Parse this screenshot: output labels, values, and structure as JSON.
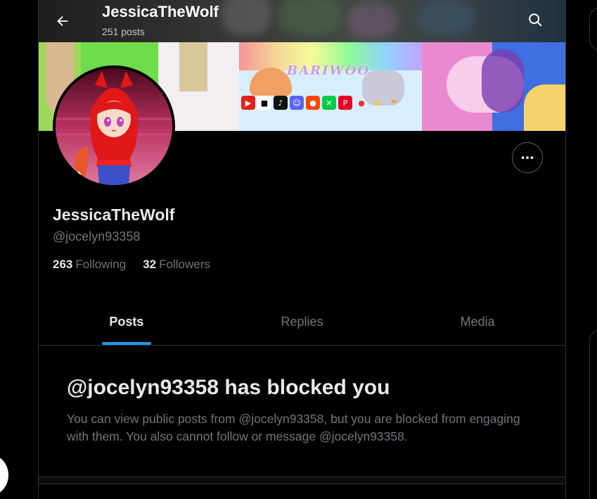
{
  "header": {
    "title": "JessicaTheWolf",
    "post_count": "251 posts",
    "back_icon": "arrow-left-icon",
    "search_icon": "search-icon"
  },
  "banner": {
    "logo_text": "BARIWOO"
  },
  "profile": {
    "display_name": "JessicaTheWolf",
    "handle": "@jocelyn93358",
    "following_count": "263",
    "following_label": "Following",
    "followers_count": "32",
    "followers_label": "Followers",
    "more_icon": "more-horizontal-icon"
  },
  "tabs": [
    {
      "label": "Posts",
      "active": true
    },
    {
      "label": "Replies",
      "active": false
    },
    {
      "label": "Media",
      "active": false
    }
  ],
  "blocked_notice": {
    "title": "@jocelyn93358 has blocked you",
    "body": "You can view public posts from @jocelyn93358, but you are blocked from engaging with them. You also cannot follow or message @jocelyn93358."
  },
  "colors": {
    "background": "#000000",
    "text_primary": "#e7e9ea",
    "text_secondary": "#71767b",
    "accent": "#1d9bf0",
    "border": "#2f3336"
  }
}
